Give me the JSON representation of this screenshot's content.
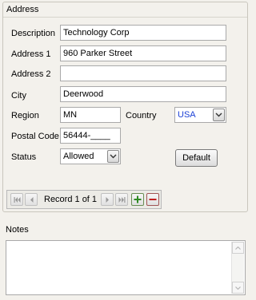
{
  "group": {
    "title": "Address"
  },
  "fields": {
    "description": {
      "label": "Description",
      "value": "Technology Corp"
    },
    "address1": {
      "label": "Address 1",
      "value": "960 Parker Street"
    },
    "address2": {
      "label": "Address 2",
      "value": ""
    },
    "city": {
      "label": "City",
      "value": "Deerwood"
    },
    "region": {
      "label": "Region",
      "value": "MN"
    },
    "country": {
      "label": "Country",
      "value": "USA",
      "color": "#1a3fd6"
    },
    "postal": {
      "label": "Postal Code",
      "value": "56444-____"
    },
    "status": {
      "label": "Status",
      "value": "Allowed"
    }
  },
  "buttons": {
    "default_label": "Default"
  },
  "navigator": {
    "record_text": "Record 1 of 1",
    "icons": [
      "first-record-icon",
      "previous-record-icon",
      "next-record-icon",
      "last-record-icon",
      "add-record-icon",
      "delete-record-icon"
    ],
    "add_color": "#2e8b22",
    "delete_color": "#c22020"
  },
  "notes": {
    "label": "Notes",
    "value": ""
  }
}
